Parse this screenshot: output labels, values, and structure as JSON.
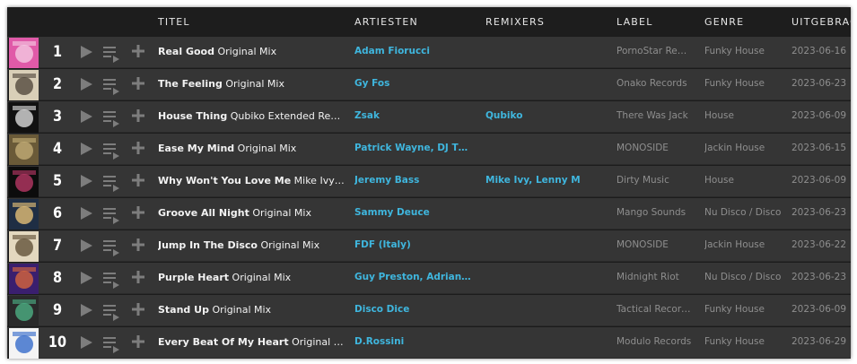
{
  "header": {
    "title": "TITEL",
    "artists": "ARTIESTEN",
    "remixers": "REMIXERS",
    "label": "LABEL",
    "genre": "GENRE",
    "released": "UITGEBRACHT"
  },
  "colors": {
    "background": "#2a2a2a",
    "header_bg": "#1d1d1d",
    "row_bg": "#353535",
    "accent_link": "#3fb6de",
    "muted_text": "#8e8e8e",
    "icon_grey": "#7d7d7d"
  },
  "tracks": [
    {
      "num": "1",
      "name": "Real Good",
      "mix": "Original Mix",
      "artists": "Adam Fiorucci",
      "remixers": "",
      "label": "PornoStar Records",
      "genre": "Funky House",
      "date": "2023-06-16",
      "art_colors": [
        "#e05aa8",
        "#f5d0e6"
      ],
      "art_text": "REAL GOOD"
    },
    {
      "num": "2",
      "name": "The Feeling",
      "mix": "Original Mix",
      "artists": "Gy Fos",
      "remixers": "",
      "label": "Onako Records",
      "genre": "Funky House",
      "date": "2023-06-23",
      "art_colors": [
        "#d9cfb8",
        "#4a4036"
      ],
      "art_text": ""
    },
    {
      "num": "3",
      "name": "House Thing",
      "mix": "Qubiko Extended Remix",
      "artists": "Zsak",
      "remixers": "Qubiko",
      "label": "There Was Jack",
      "genre": "House",
      "date": "2023-06-09",
      "art_colors": [
        "#111111",
        "#e8e8e8"
      ],
      "art_text": ""
    },
    {
      "num": "4",
      "name": "Ease My Mind",
      "mix": "Original Mix",
      "artists": "Patrick Wayne, DJ THREESIXTY",
      "remixers": "",
      "label": "MONOSIDE",
      "genre": "Jackin House",
      "date": "2023-06-15",
      "art_colors": [
        "#6a5a38",
        "#c8b27a"
      ],
      "art_text": ""
    },
    {
      "num": "5",
      "name": "Why Won't You Love Me",
      "mix": "Mike Ivy & Lenny M Remix",
      "artists": "Jeremy Bass",
      "remixers": "Mike Ivy, Lenny M",
      "label": "Dirty Music",
      "genre": "House",
      "date": "2023-06-09",
      "art_colors": [
        "#0c0c0c",
        "#c23a6a"
      ],
      "art_text": ""
    },
    {
      "num": "6",
      "name": "Groove All Night",
      "mix": "Original Mix",
      "artists": "Sammy Deuce",
      "remixers": "",
      "label": "Mango Sounds",
      "genre": "Nu Disco / Disco",
      "date": "2023-06-23",
      "art_colors": [
        "#1f2e44",
        "#f0c87a"
      ],
      "art_text": ""
    },
    {
      "num": "7",
      "name": "Jump In The Disco",
      "mix": "Original Mix",
      "artists": "FDF (Italy)",
      "remixers": "",
      "label": "MONOSIDE",
      "genre": "Jackin House",
      "date": "2023-06-22",
      "art_colors": [
        "#e3d8bf",
        "#5a4a30"
      ],
      "art_text": ""
    },
    {
      "num": "8",
      "name": "Purple Heart",
      "mix": "Original Mix",
      "artists": "Guy Preston, Adrian Cruz",
      "remixers": "",
      "label": "Midnight Riot",
      "genre": "Nu Disco / Disco",
      "date": "2023-06-23",
      "art_colors": [
        "#3a1f6e",
        "#e06a3a"
      ],
      "art_text": ""
    },
    {
      "num": "9",
      "name": "Stand Up",
      "mix": "Original Mix",
      "artists": "Disco Dice",
      "remixers": "",
      "label": "Tactical Records",
      "genre": "Funky House",
      "date": "2023-06-09",
      "art_colors": [
        "#2a2a2a",
        "#4fb88a"
      ],
      "art_text": ""
    },
    {
      "num": "10",
      "name": "Every Beat Of My Heart",
      "mix": "Original Mix",
      "artists": "D.Rossini",
      "remixers": "",
      "label": "Modulo Records",
      "genre": "Funky House",
      "date": "2023-06-29",
      "art_colors": [
        "#f4f4f4",
        "#2a63c8"
      ],
      "art_text": ""
    }
  ]
}
